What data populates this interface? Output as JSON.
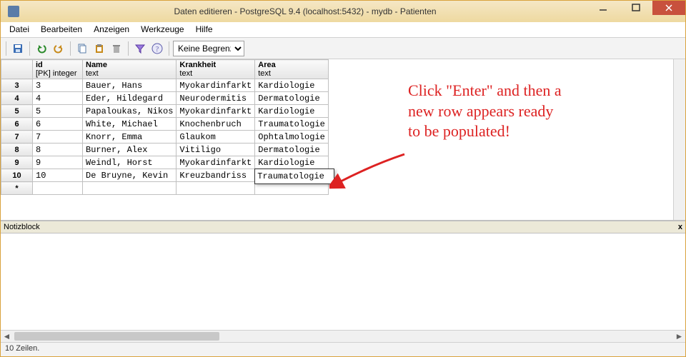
{
  "window": {
    "title": "Daten editieren - PostgreSQL 9.4 (localhost:5432) - mydb - Patienten"
  },
  "menu": {
    "items": [
      "Datei",
      "Bearbeiten",
      "Anzeigen",
      "Werkzeuge",
      "Hilfe"
    ]
  },
  "toolbar": {
    "limit_select": "Keine Begrenzu"
  },
  "grid": {
    "columns": [
      {
        "name": "id",
        "type": "[PK] integer"
      },
      {
        "name": "Name",
        "type": "text"
      },
      {
        "name": "Krankheit",
        "type": "text"
      },
      {
        "name": "Area",
        "type": "text"
      }
    ],
    "rows": [
      {
        "num": "3",
        "id": "3",
        "name": "Bauer, Hans",
        "krankheit": "Myokardinfarkt",
        "area": "Kardiologie"
      },
      {
        "num": "4",
        "id": "4",
        "name": "Eder, Hildegard",
        "krankheit": "Neurodermitis",
        "area": "Dermatologie"
      },
      {
        "num": "5",
        "id": "5",
        "name": "Papaloukas, Nikos",
        "krankheit": "Myokardinfarkt",
        "area": "Kardiologie"
      },
      {
        "num": "6",
        "id": "6",
        "name": "White, Michael",
        "krankheit": "Knochenbruch",
        "area": "Traumatologie"
      },
      {
        "num": "7",
        "id": "7",
        "name": "Knorr, Emma",
        "krankheit": "Glaukom",
        "area": "Ophtalmologie"
      },
      {
        "num": "8",
        "id": "8",
        "name": "Burner, Alex",
        "krankheit": "Vitiligo",
        "area": "Dermatologie"
      },
      {
        "num": "9",
        "id": "9",
        "name": "Weindl, Horst",
        "krankheit": "Myokardinfarkt",
        "area": "Kardiologie"
      },
      {
        "num": "10",
        "id": "10",
        "name": "De Bruyne, Kevin",
        "krankheit": "Kreuzbandriss",
        "area": "Traumatologie"
      }
    ],
    "new_row_marker": "*",
    "editing_value": "Traumatologie"
  },
  "annotation": {
    "line1": "Click \"Enter\" and then a",
    "line2": "new row appears ready",
    "line3": "to be populated!"
  },
  "panel": {
    "title": "Notizblock",
    "close": "x"
  },
  "status": {
    "text": "10 Zeilen."
  }
}
